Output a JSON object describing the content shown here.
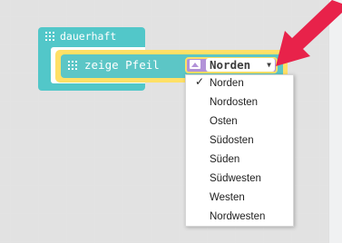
{
  "workspace": {
    "event_block": {
      "label": "dauerhaft",
      "icon": "grid-icon"
    },
    "statement_block": {
      "label": "zeige Pfeil",
      "icon": "grid-icon"
    },
    "field": {
      "icon": "image-icon",
      "value": "Norden",
      "dropdown_indicator": "▼"
    }
  },
  "dropdown": {
    "selected": "Norden",
    "checkmark": "✓",
    "options": [
      {
        "label": "Norden"
      },
      {
        "label": "Nordosten"
      },
      {
        "label": "Osten"
      },
      {
        "label": "Südosten"
      },
      {
        "label": "Süden"
      },
      {
        "label": "Südwesten"
      },
      {
        "label": "Westen"
      },
      {
        "label": "Nordwesten"
      }
    ]
  },
  "colors": {
    "event_block": "#52c7c9",
    "statement_block_border": "#ffe066",
    "statement_block": "#5cc6c6",
    "field_bg": "#b292d8",
    "arrow": "#e8224a"
  },
  "annotation": {
    "icon": "red-arrow-icon"
  }
}
